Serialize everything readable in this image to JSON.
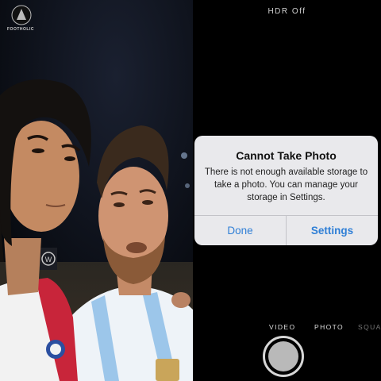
{
  "watermark": {
    "text": "FOOTHOLIC"
  },
  "camera": {
    "hdr_status": "HDR Off",
    "modes": {
      "video": "VIDEO",
      "photo": "PHOTO",
      "square": "SQUA"
    }
  },
  "alert": {
    "title": "Cannot Take Photo",
    "message": "There is not enough available storage to take a photo. You can manage your storage in Settings.",
    "buttons": {
      "done": "Done",
      "settings": "Settings"
    }
  },
  "colors": {
    "alert_bg": "#e9e9ec",
    "button_blue": "#2f7fd6"
  }
}
